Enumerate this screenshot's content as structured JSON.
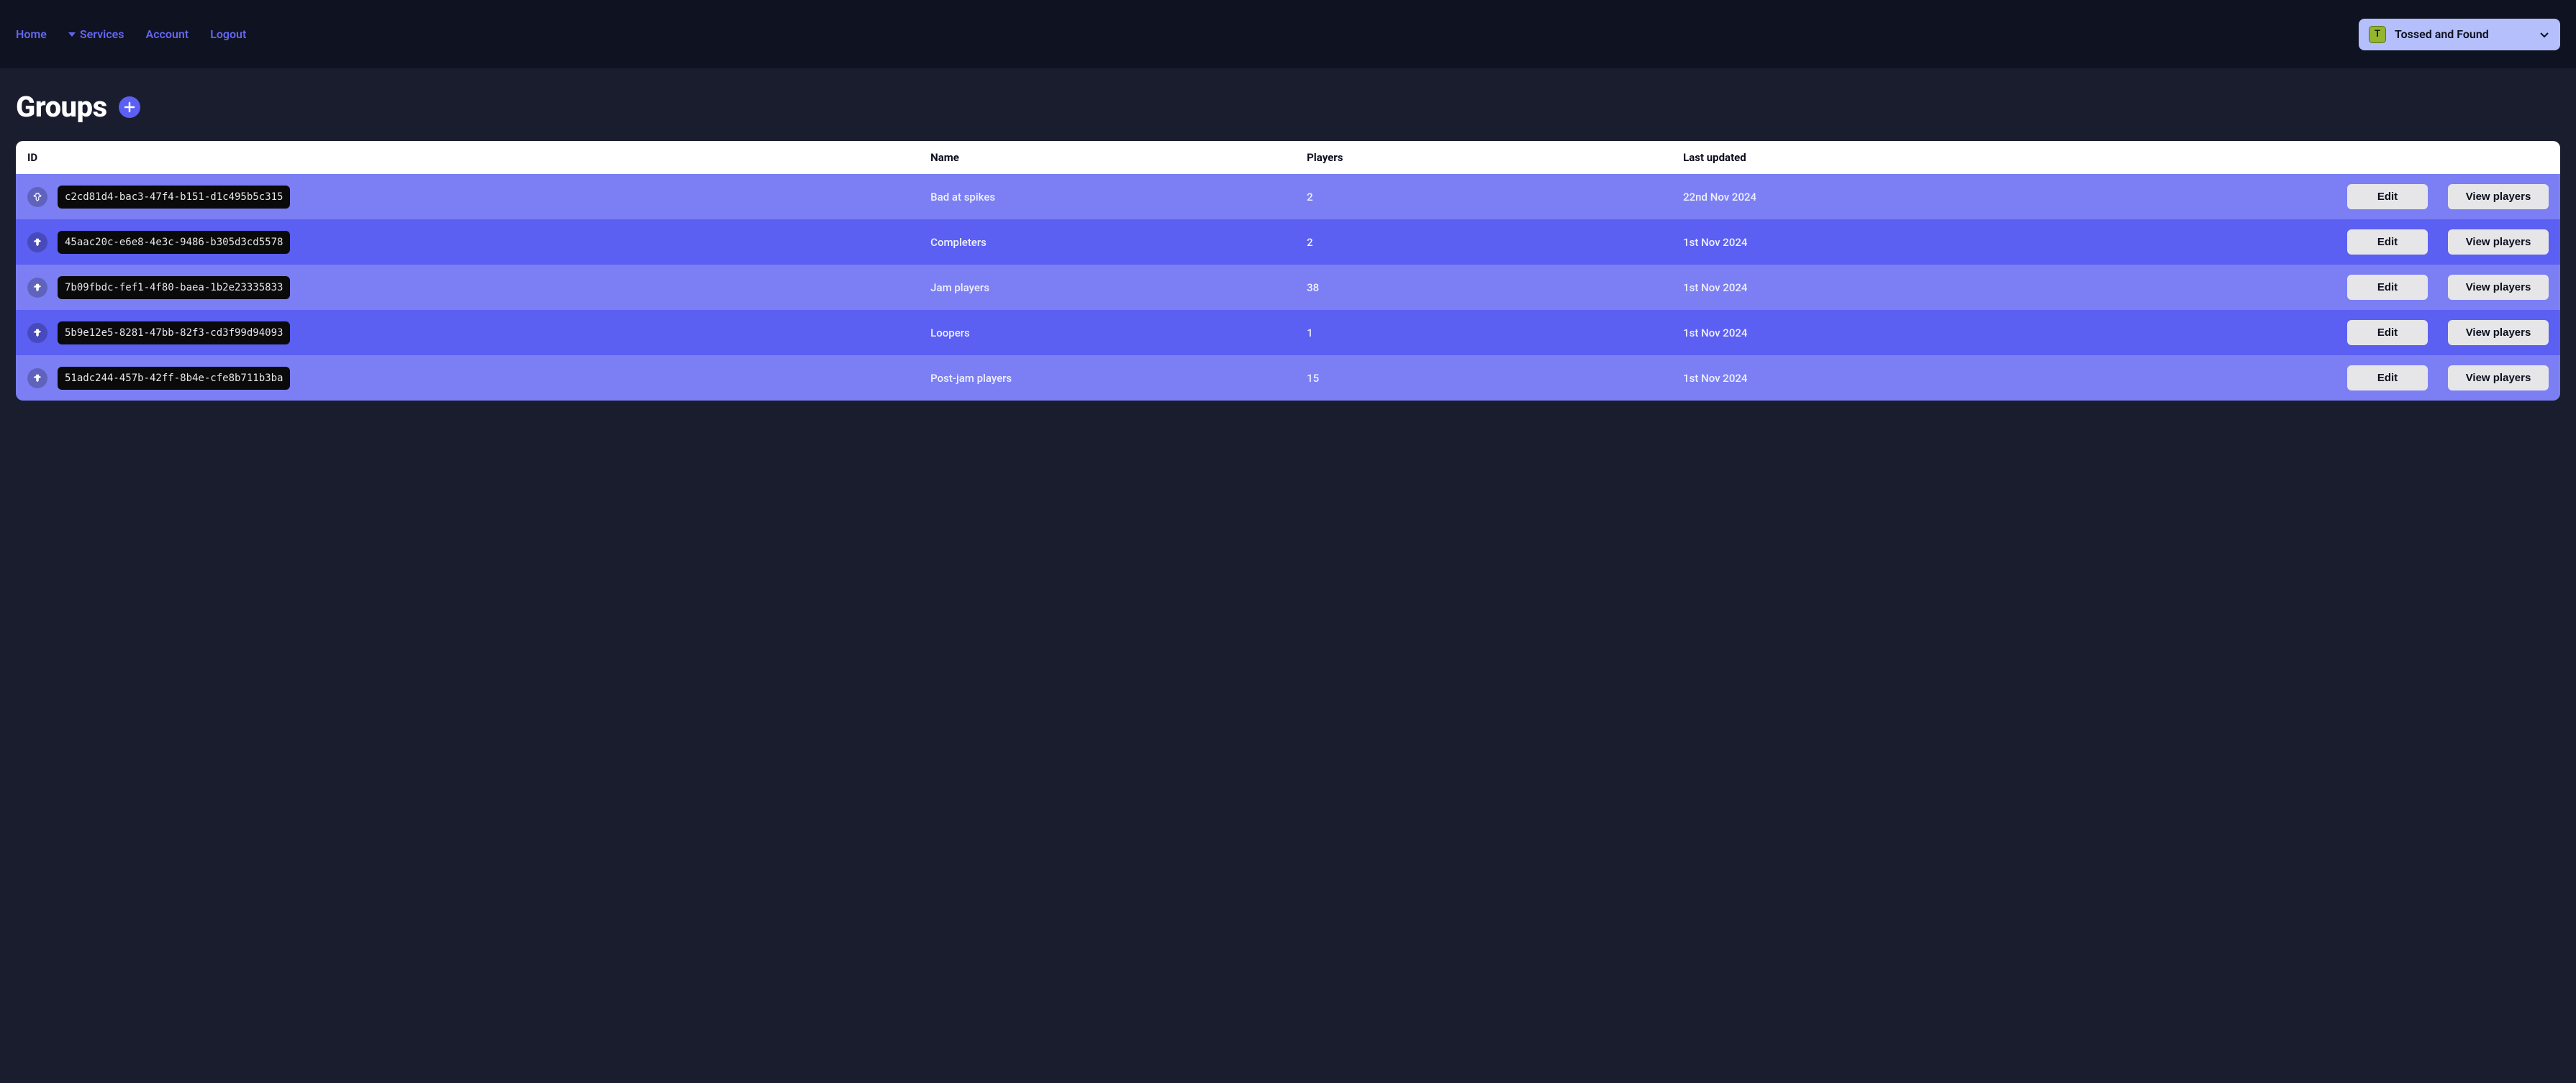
{
  "nav": {
    "home": "Home",
    "services": "Services",
    "account": "Account",
    "logout": "Logout"
  },
  "game_selector": {
    "badge_letter": "T",
    "name": "Tossed and Found"
  },
  "page": {
    "title": "Groups"
  },
  "table": {
    "columns": {
      "id": "ID",
      "name": "Name",
      "players": "Players",
      "last_updated": "Last updated"
    },
    "actions": {
      "edit": "Edit",
      "view_players": "View players"
    },
    "rows": [
      {
        "pinned": true,
        "id": "c2cd81d4-bac3-47f4-b151-d1c495b5c315",
        "name": "Bad at spikes",
        "players": "2",
        "last_updated": "22nd Nov 2024"
      },
      {
        "pinned": false,
        "id": "45aac20c-e6e8-4e3c-9486-b305d3cd5578",
        "name": "Completers",
        "players": "2",
        "last_updated": "1st Nov 2024"
      },
      {
        "pinned": false,
        "id": "7b09fbdc-fef1-4f80-baea-1b2e23335833",
        "name": "Jam players",
        "players": "38",
        "last_updated": "1st Nov 2024"
      },
      {
        "pinned": false,
        "id": "5b9e12e5-8281-47bb-82f3-cd3f99d94093",
        "name": "Loopers",
        "players": "1",
        "last_updated": "1st Nov 2024"
      },
      {
        "pinned": false,
        "id": "51adc244-457b-42ff-8b4e-cfe8b711b3ba",
        "name": "Post-jam players",
        "players": "15",
        "last_updated": "1st Nov 2024"
      }
    ]
  }
}
